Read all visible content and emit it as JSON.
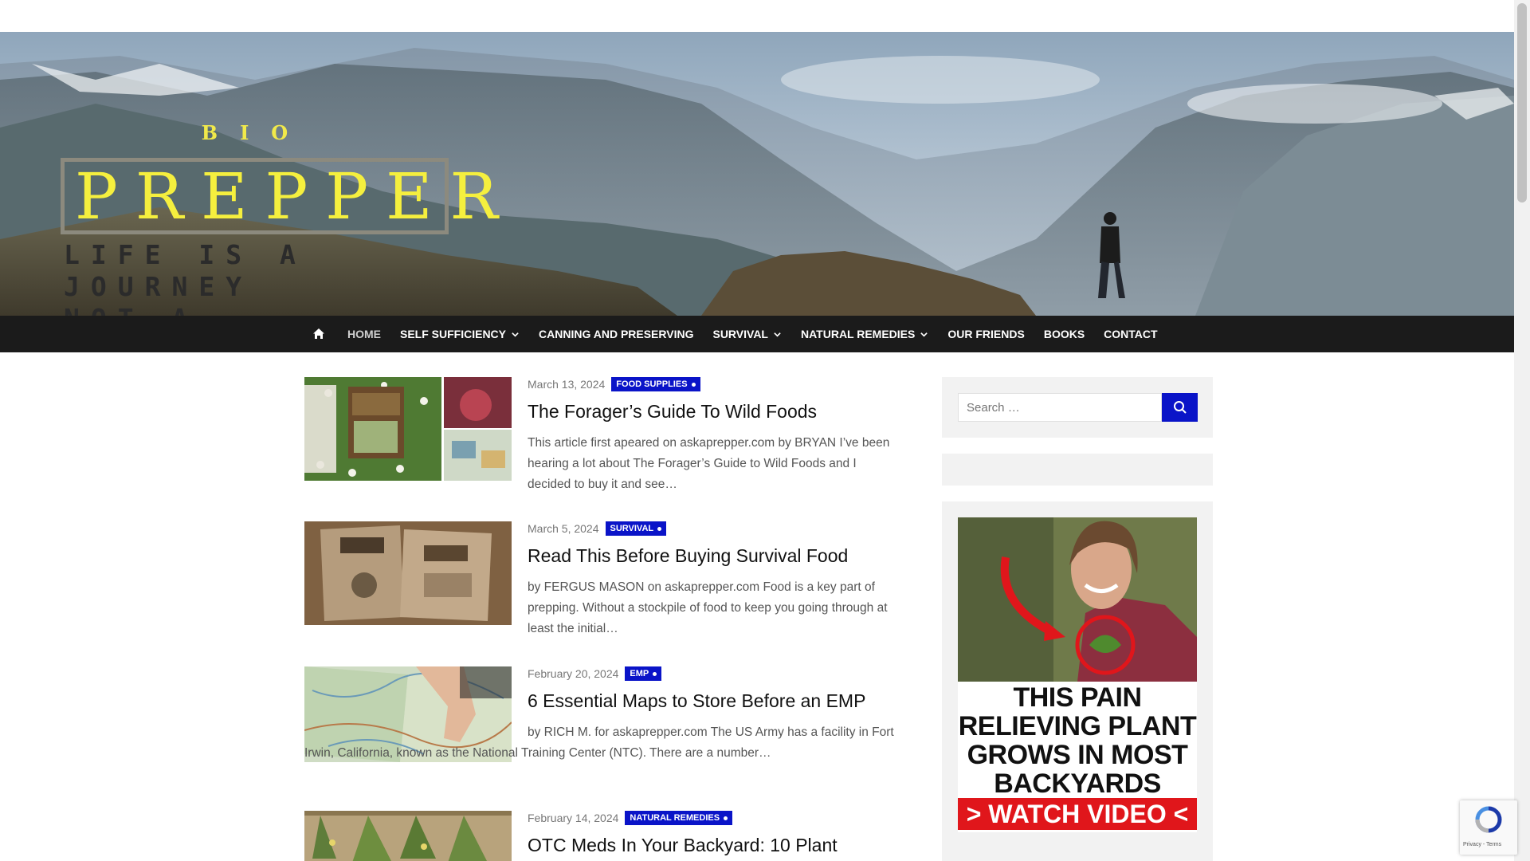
{
  "site": {
    "logo_top": "BIO",
    "logo_main": "PREPPER",
    "tagline_line1": "LIFE IS A JOURNEY",
    "tagline_line2": "NOT A DESTINATION"
  },
  "nav": {
    "items": [
      {
        "label": "HOME",
        "active": true,
        "dropdown": false
      },
      {
        "label": "SELF SUFFICIENCY",
        "dropdown": true
      },
      {
        "label": "CANNING AND PRESERVING",
        "dropdown": false
      },
      {
        "label": "SURVIVAL",
        "dropdown": true
      },
      {
        "label": "NATURAL REMEDIES",
        "dropdown": true
      },
      {
        "label": "OUR FRIENDS",
        "dropdown": false
      },
      {
        "label": "BOOKS",
        "dropdown": false
      },
      {
        "label": "CONTACT",
        "dropdown": false
      }
    ]
  },
  "posts": [
    {
      "date": "March 13, 2024",
      "category": "FOOD SUPPLIES",
      "title": "The Forager’s Guide To Wild Foods",
      "excerpt": "This article first apeared on askaprepper.com  by BRYAN I’ve been hearing a lot about The Forager’s Guide to Wild Foods and I decided to buy it and see…"
    },
    {
      "date": "March 5, 2024",
      "category": "SURVIVAL",
      "title": "Read This Before Buying Survival Food",
      "excerpt": " by FERGUS MASON on askaprepper.com Food is a key part of prepping. Without a stockpile of food to keep you going through at least the initial…"
    },
    {
      "date": "February 20, 2024",
      "category": "EMP",
      "title": "6 Essential Maps to Store Before an EMP",
      "excerpt": " by RICH M. for askaprepper.com The US Army has a facility in Fort Irwin, California, known as the National Training Center (NTC). There are a number…"
    },
    {
      "date": "February 14, 2024",
      "category": "NATURAL REMEDIES",
      "title": "OTC Meds In Your Backyard: 10 Plant"
    }
  ],
  "sidebar": {
    "search_placeholder": "Search …",
    "ad_headline": "THIS PAIN RELIEVING PLANT GROWS IN MOST BACKYARDS",
    "ad_cta": "> WATCH VIDEO <"
  },
  "recaptcha": {
    "footer": "Privacy - Terms"
  },
  "colors": {
    "accent": "#0a14c8",
    "nav_bg": "#1b1b1b",
    "logo_yellow": "#f5ef3e",
    "ad_red": "#e0161b"
  }
}
